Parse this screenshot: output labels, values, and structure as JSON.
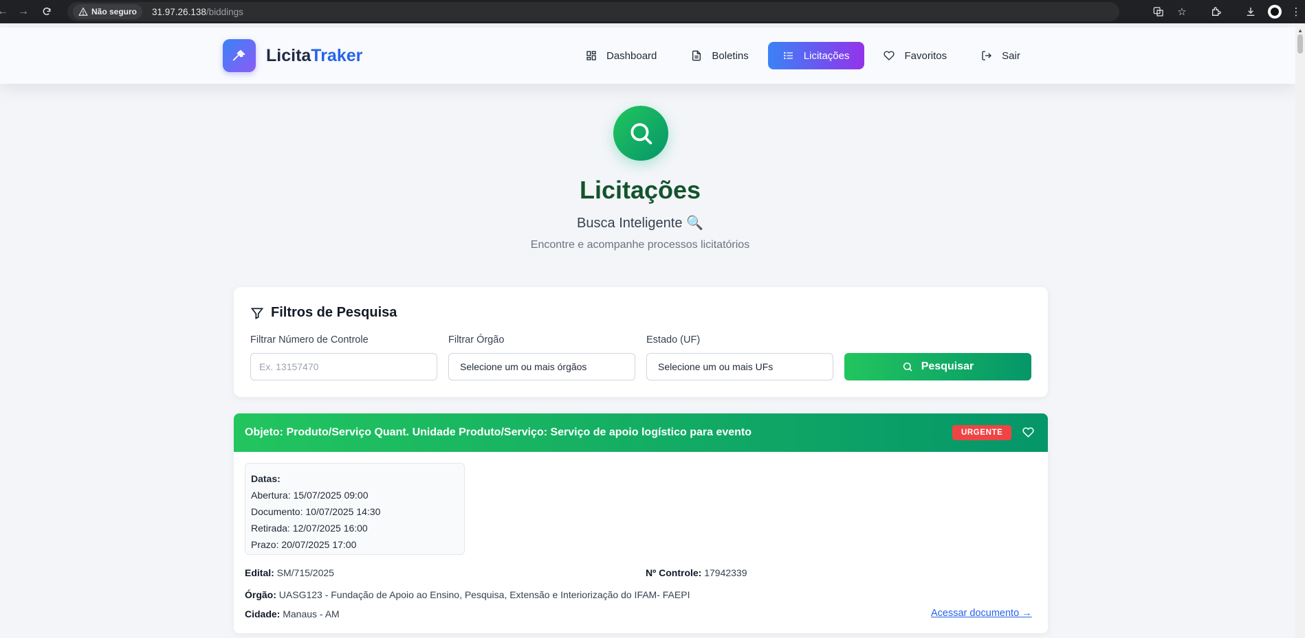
{
  "browser": {
    "security_label": "Não seguro",
    "url_host": "31.97.26.138",
    "url_path": "/biddings"
  },
  "brand": {
    "name_part1": "Licita",
    "name_part2": "Traker"
  },
  "nav": [
    {
      "label": "Dashboard",
      "icon": "dashboard-icon",
      "active": false
    },
    {
      "label": "Boletins",
      "icon": "document-icon",
      "active": false
    },
    {
      "label": "Licitações",
      "icon": "list-icon",
      "active": true
    },
    {
      "label": "Favoritos",
      "icon": "heart-icon",
      "active": false
    },
    {
      "label": "Sair",
      "icon": "logout-icon",
      "active": false
    }
  ],
  "hero": {
    "title": "Licitações",
    "subtitle": "Busca Inteligente",
    "subtitle_emoji": "🔍",
    "description": "Encontre e acompanhe processos licitatórios"
  },
  "filters": {
    "title": "Filtros de Pesquisa",
    "control_number_label": "Filtrar Número de Controle",
    "control_number_placeholder": "Ex. 13157470",
    "organ_label": "Filtrar Órgão",
    "organ_value": "Selecione um ou mais órgãos",
    "state_label": "Estado (UF)",
    "state_value": "Selecione um ou mais UFs",
    "search_button": "Pesquisar"
  },
  "results": [
    {
      "objeto": "Objeto: Produto/Serviço Quant. Unidade Produto/Serviço: Serviço de apoio logístico para evento",
      "badge": "URGENTE",
      "dates_title": "Datas:",
      "abertura_label": "Abertura:",
      "abertura": "15/07/2025 09:00",
      "documento_label": "Documento:",
      "documento": "10/07/2025 14:30",
      "retirada_label": "Retirada:",
      "retirada": "12/07/2025 16:00",
      "prazo_label": "Prazo:",
      "prazo": "20/07/2025 17:00",
      "edital_label": "Edital:",
      "edital": "SM/715/2025",
      "controle_label": "Nº Controle:",
      "controle": "17942339",
      "orgao_label": "Órgão:",
      "orgao": "UASG123 - Fundação de Apoio ao Ensino, Pesquisa, Extensão e Interiorização do IFAM- FAEPI",
      "cidade_label": "Cidade:",
      "cidade": "Manaus - AM",
      "link": "Acessar documento →"
    }
  ],
  "colors": {
    "primary_gradient_start": "#3b82f6",
    "primary_gradient_end": "#9333ea",
    "green_start": "#22c55e",
    "green_end": "#059669",
    "urgent": "#ef4444"
  }
}
